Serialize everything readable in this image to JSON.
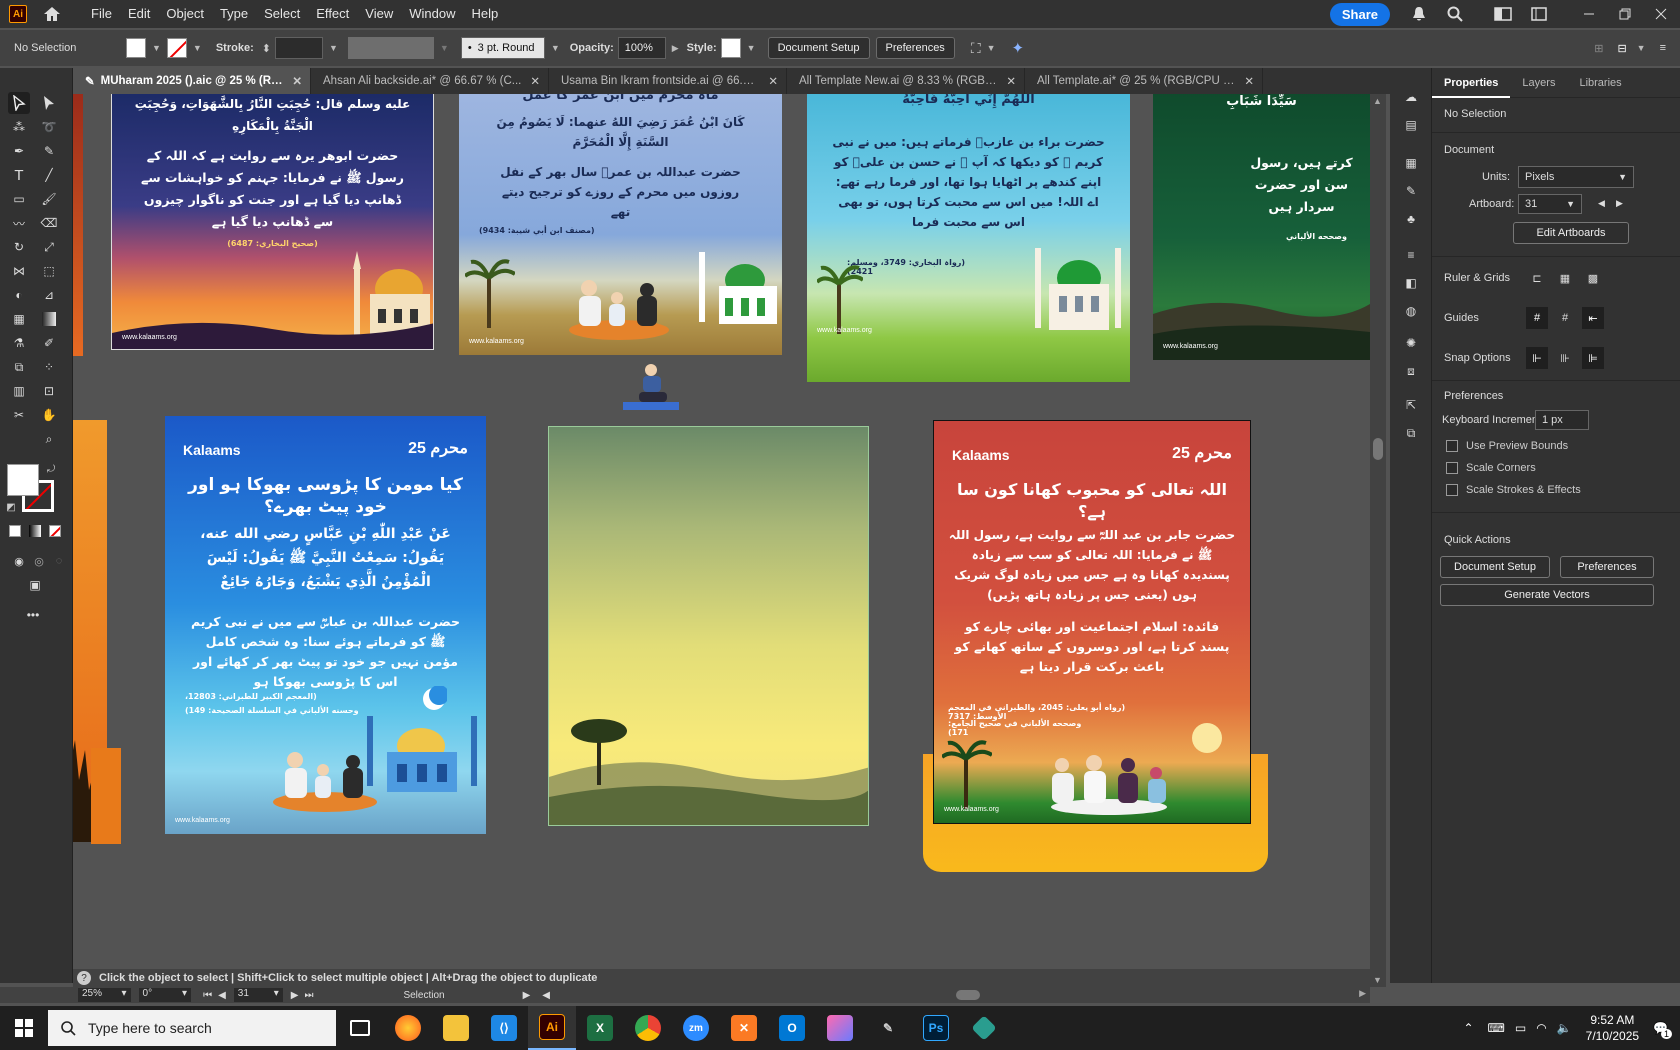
{
  "app": {
    "logo": "Ai",
    "home_icon": "home-icon"
  },
  "menu": [
    "File",
    "Edit",
    "Object",
    "Type",
    "Select",
    "Effect",
    "View",
    "Window",
    "Help"
  ],
  "menubar_right": {
    "share_label": "Share",
    "icons": [
      "bell-icon",
      "search-icon",
      "workspace-icon",
      "arrange-icon"
    ]
  },
  "control": {
    "selection": "No Selection",
    "stroke_label": "Stroke:",
    "brush": "3 pt. Round",
    "opacity_label": "Opacity:",
    "opacity_value": "100%",
    "style_label": "Style:",
    "doc_setup": "Document Setup",
    "preferences": "Preferences"
  },
  "tabs": [
    {
      "title": "MUharam 2025 ().aic @ 25 % (RGB/CPU Preview)",
      "active": true
    },
    {
      "title": "Ahsan Ali backside.ai* @ 66.67 % (C...",
      "active": false
    },
    {
      "title": "Usama Bin Ikram frontside.ai @ 66.67...",
      "active": false
    },
    {
      "title": "All Template New.ai @ 8.33 % (RGB/C...",
      "active": false
    },
    {
      "title": "All Template.ai* @ 25 % (RGB/CPU Pr...",
      "active": false
    }
  ],
  "artboards": {
    "top1": {
      "text1": "عليه وسلم قال: حُجِبَتِ النَّارُ بِالشَّهَوَاتِ، وَحُجِبَتِ الْجَنَّةُ بِالْمَكَارِهِ",
      "text2": "حضرت ابوهر یرہ سے روایت ہے کہ اللہ کے رسول ﷺ نے فرمایا: جہنم کو خواہشات سے ڈھانپ دیا گیا ہے اور جنت کو ناگوار چیزوں سے ڈھانپ دیا گیا ہے",
      "ref": "(صحیح البخاري: 6487)",
      "site": "www.kalaams.org"
    },
    "top2": {
      "heading": "ماہ محرم میں ابن عمر کا عمل",
      "text1": "كَانَ ابْنُ عُمَرَ رَضِيَ اللهُ عنهما: لَا يَصُومُ مِنَ السَّنَةِ إِلَّا الْمُحَرَّمَ",
      "text2": "حضرت عبداللہ بن عمرؓ سال بھر کے نفل روزوں میں محرم کے روزے کو ترجیح دیتے تھے",
      "ref": "(مصنف ابن أبي شيبة: 9434)",
      "site": "www.kalaams.org"
    },
    "top3": {
      "text1": "اَللّٰهُمَّ إِنِّي أُحِبُّهُ فَأَحِبَّهُ",
      "text2": "حضرت براء بن عازبؓ فرماتے ہیں: میں نے نبی کریم ﷺ کو دیکھا کہ آپ ﷺ نے حسن بن علیؓ کو اپنے کندھے پر اٹھایا ہوا تھا، اور فرما رہے تھے: اے اللہ! میں اس سے محبت کرتا ہوں، تو بھی اس سے محبت فرما",
      "ref": "(رواہ البخاري: 3749، ومسلم: 2421)",
      "site": "www.kalaams.org"
    },
    "top4": {
      "text1": "سَيِّدَا شَبَابِ",
      "text2": "کرتے ہیں، رسول سن اور حضرت سردار ہیں",
      "ref": "وصححه الألباني",
      "site": "www.kalaams.org"
    },
    "blue": {
      "brand": "Kalaams",
      "badge": "محرم 25",
      "title": "کیا مومن کا پڑوسی بھوکا ہو اور خود پیٹ بھرے؟",
      "arabic": "عَنْ عَبْدِ اللّٰهِ بْنِ عَبَّاسٍ رضي الله عنه، يَقُولُ: سَمِعْتُ النَّبِيَّ ﷺ يَقُولُ: لَيْسَ الْمُؤْمِنُ الَّذِي يَشْبَعُ، وَجَارُهُ جَائِعٌ",
      "urdu": "حضرت عبداللہ بن عباسؓ سے میں نے نبی کریم ﷺ کو فرماتے ہوئے سنا: وہ شخص کامل مؤمن نہیں جو خود تو پیٹ بھر کر کھائے اور اس کا پڑوسی بھوکا ہو",
      "ref1": "(المعجم الكبير للطبراني: 12803،",
      "ref2": "وحسنه الألباني في السلسلة الصحيحة: 149)",
      "site": "www.kalaams.org"
    },
    "red": {
      "brand": "Kalaams",
      "badge": "محرم 25",
      "title": "اللہ تعالی کو محبوب کھانا کون سا ہے؟",
      "urdu1": "حضرت جابر بن عبد اللہؓ سے روایت ہے، رسول اللہ ﷺ نے فرمایا: اللہ تعالی کو سب سے زیادہ پسندیدہ کھانا وہ ہے جس میں زیادہ لوگ شریک ہوں (یعنی جس پر زیادہ ہاتھ پڑیں)",
      "urdu2": "فائدہ: اسلام اجتماعیت اور بھائی چارے کو پسند کرتا ہے، اور دوسروں کے ساتھ کھانے کو باعث برکت قرار دیتا ہے",
      "ref1": "(رواه أبو يعلى: 2045، والطبراني في المعجم الأوسط: 7317",
      "ref2": "وصححه الألباني في صحيح الجامع: 171)",
      "site": "www.kalaams.org"
    }
  },
  "properties": {
    "tabs": [
      "Properties",
      "Layers",
      "Libraries"
    ],
    "selection": "No Selection",
    "document_label": "Document",
    "units_label": "Units:",
    "units_value": "Pixels",
    "artboard_label": "Artboard:",
    "artboard_value": "31",
    "edit_artboards": "Edit Artboards",
    "ruler_grids": "Ruler & Grids",
    "guides": "Guides",
    "snap_options": "Snap Options",
    "preferences": "Preferences",
    "keyboard_increment_label": "Keyboard Increment:",
    "keyboard_increment_value": "1 px",
    "checkboxes": [
      "Use Preview Bounds",
      "Scale Corners",
      "Scale Strokes & Effects"
    ],
    "quick_actions": "Quick Actions",
    "doc_setup": "Document Setup",
    "preferences_btn": "Preferences",
    "generate_vectors": "Generate Vectors"
  },
  "status": {
    "hint": "Click the object to select  |  Shift+Click to select multiple object  |  Alt+Drag the object to duplicate",
    "zoom": "25%",
    "rotation": "0°",
    "artboard_nav": "31",
    "tool": "Selection"
  },
  "taskbar": {
    "search_placeholder": "Type here to search",
    "apps": [
      "task-view",
      "firefox",
      "file-explorer",
      "vscode",
      "illustrator",
      "excel",
      "chrome",
      "zoom",
      "xampp",
      "outlook",
      "paint",
      "tool",
      "photoshop",
      "app"
    ],
    "time": "9:52 AM",
    "date": "7/10/2025",
    "notifications": "1"
  },
  "colors": {
    "accent": "#1473e6",
    "ui_dark": "#323232",
    "canvas": "#535353"
  }
}
